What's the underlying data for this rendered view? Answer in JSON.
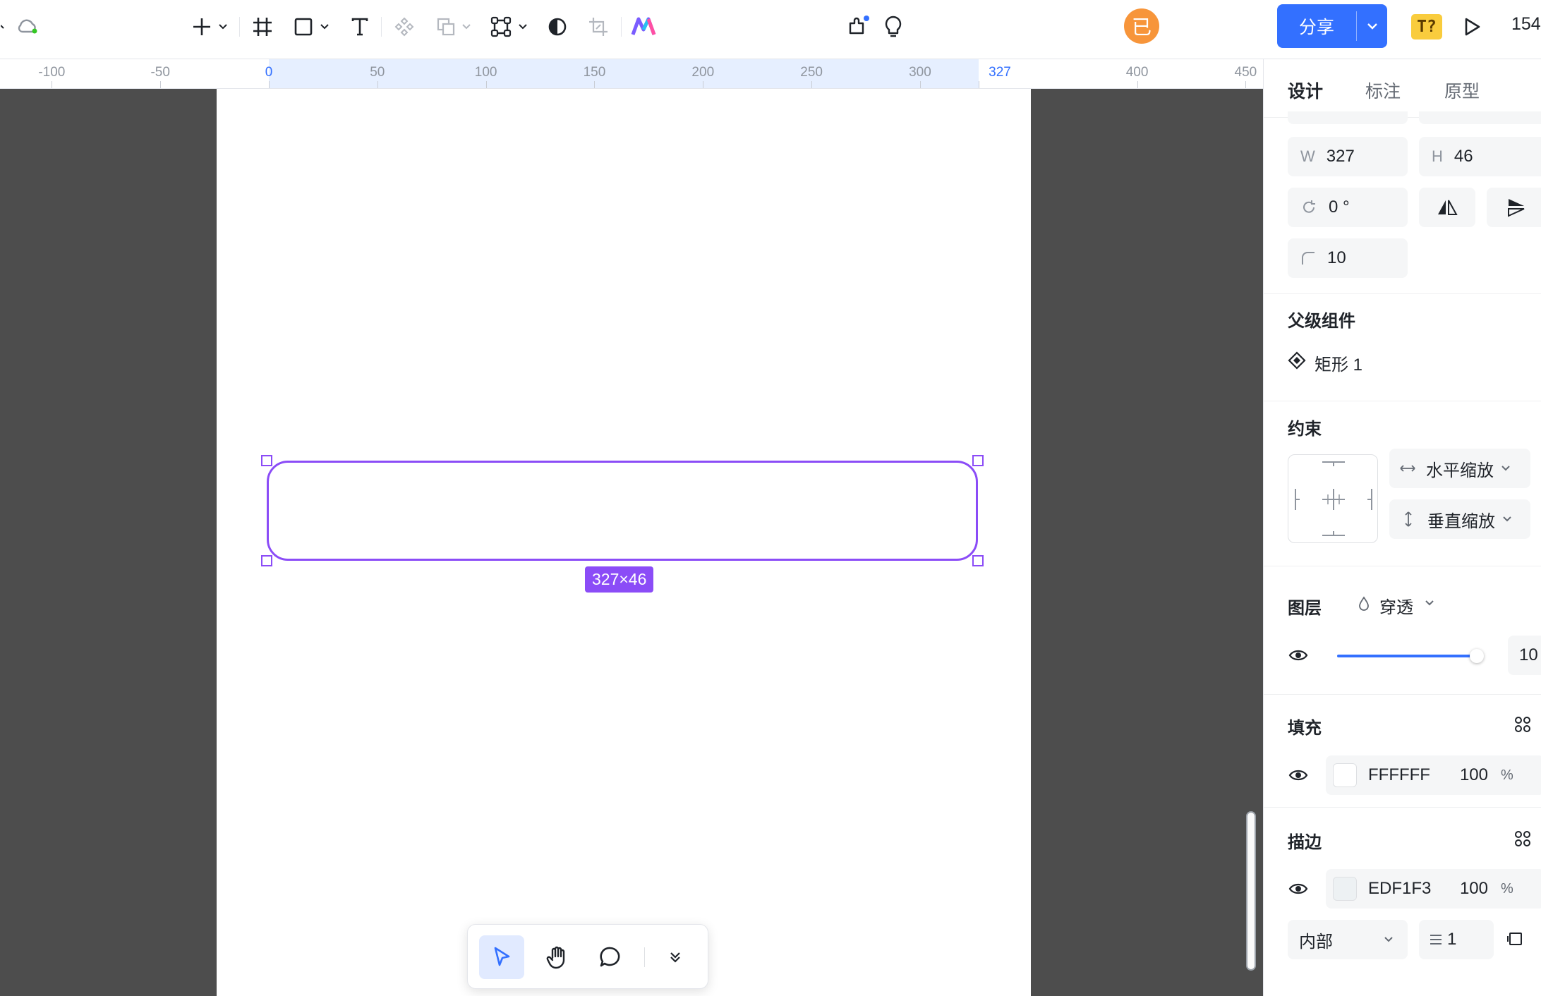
{
  "toolbar": {
    "share_label": "分享",
    "avatar_text": "已",
    "t_badge": "T?",
    "zoom_partial": "154"
  },
  "ruler": {
    "labels": [
      "-100",
      "-50",
      "0",
      "50",
      "100",
      "150",
      "200",
      "250",
      "300",
      "327",
      "400",
      "450"
    ]
  },
  "canvas": {
    "selection_size": "327×46"
  },
  "panel": {
    "tabs": [
      "设计",
      "标注",
      "原型"
    ],
    "width_prefix": "W",
    "width_value": "327",
    "height_prefix": "H",
    "height_value": "46",
    "rotation_value": "0 °",
    "radius_value": "10",
    "parent_title": "父级组件",
    "parent_name": "矩形 1",
    "constraints_title": "约束",
    "constraint_h": "水平缩放",
    "constraint_v": "垂直缩放",
    "layer_title": "图层",
    "blend_mode": "穿透",
    "opacity_partial": "10",
    "fill_title": "填充",
    "fill_hex": "FFFFFF",
    "fill_opacity": "100",
    "fill_unit": "%",
    "stroke_title": "描边",
    "stroke_hex": "EDF1F3",
    "stroke_opacity": "100",
    "stroke_unit": "%",
    "stroke_position": "内部",
    "stroke_width": "1"
  },
  "colors": {
    "accent": "#3370ff",
    "selection": "#8b4cf7",
    "canvas_bg": "#4d4d4d",
    "avatar": "#f7953a",
    "fill_swatch": "#FFFFFF",
    "stroke_swatch": "#EDF1F3"
  }
}
